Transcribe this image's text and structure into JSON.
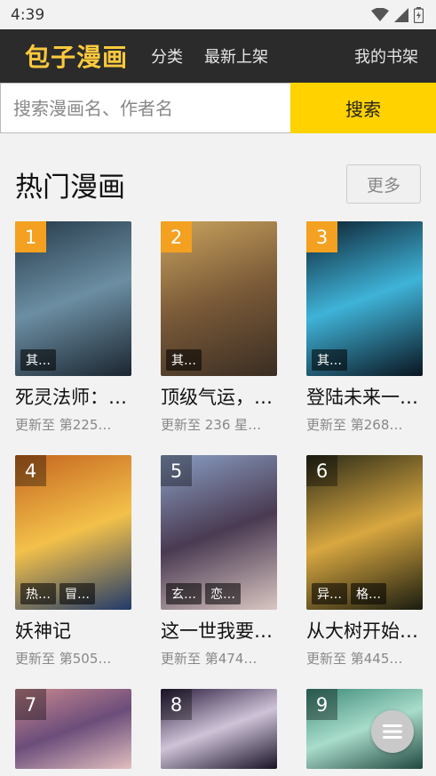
{
  "status": {
    "time": "4:39"
  },
  "header": {
    "logo": "包子漫画",
    "nav": [
      "分类",
      "最新上架"
    ],
    "bookshelf": "我的书架"
  },
  "search": {
    "placeholder": "搜索漫画名、作者名",
    "button": "搜索"
  },
  "section": {
    "title": "热门漫画",
    "more": "更多"
  },
  "comics": [
    {
      "rank": "1",
      "title": "死灵法师：…",
      "update": "更新至 第225…",
      "tags": [
        "其…"
      ],
      "colors": [
        "#263b4a",
        "#6c8ea3",
        "#1b2630"
      ]
    },
    {
      "rank": "2",
      "title": "顶级气运，…",
      "update": "更新至 236 星…",
      "tags": [
        "其…"
      ],
      "colors": [
        "#c9a35d",
        "#7a5a38",
        "#3a2d23"
      ]
    },
    {
      "rank": "3",
      "title": "登陆未来一…",
      "update": "更新至 第268…",
      "tags": [
        "其…"
      ],
      "colors": [
        "#0c2030",
        "#3fb3d8",
        "#0a1520"
      ]
    },
    {
      "rank": "4",
      "title": "妖神记",
      "update": "更新至 第505…",
      "tags": [
        "热…",
        "冒…"
      ],
      "colors": [
        "#c5641f",
        "#f3c14a",
        "#213a6a"
      ]
    },
    {
      "rank": "5",
      "title": "这一世我要…",
      "update": "更新至 第474…",
      "tags": [
        "玄…",
        "恋…"
      ],
      "colors": [
        "#8a9fc4",
        "#4a3a52",
        "#d9c6c2"
      ]
    },
    {
      "rank": "6",
      "title": "从大树开始…",
      "update": "更新至 第445…",
      "tags": [
        "异…",
        "格…"
      ],
      "colors": [
        "#2a2a18",
        "#d8a740",
        "#1a1c10"
      ]
    },
    {
      "rank": "7",
      "title": "",
      "update": "",
      "tags": [],
      "colors": [
        "#c98890",
        "#6b4d7a",
        "#e2bfc0"
      ]
    },
    {
      "rank": "8",
      "title": "",
      "update": "",
      "tags": [],
      "colors": [
        "#2b1d3e",
        "#cfc3d8",
        "#191226"
      ]
    },
    {
      "rank": "9",
      "title": "",
      "update": "",
      "tags": [],
      "colors": [
        "#3d8a78",
        "#a9dccb",
        "#20483f"
      ]
    }
  ],
  "icons": {
    "wifi": "wifi-icon",
    "signal": "signal-icon",
    "battery": "battery-icon",
    "menu": "menu-icon"
  }
}
